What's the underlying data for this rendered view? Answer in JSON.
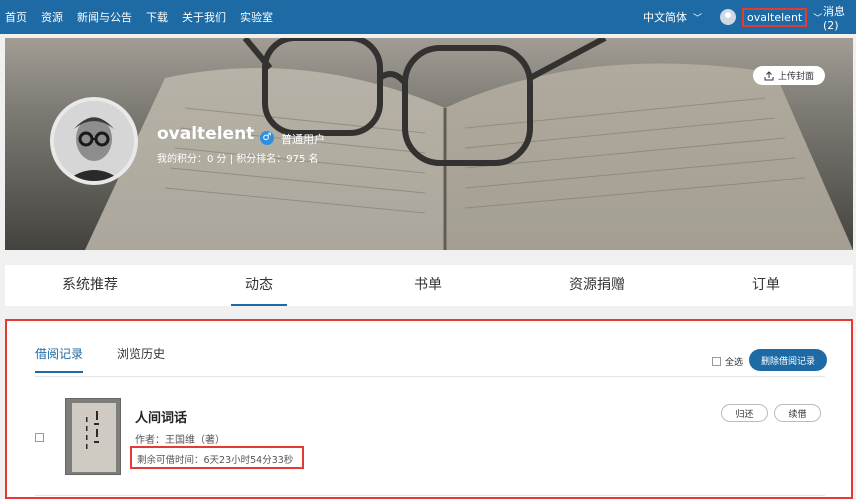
{
  "nav": {
    "links": [
      "首页",
      "资源",
      "新闻与公告",
      "下载",
      "关于我们",
      "实验室"
    ],
    "language": "中文简体",
    "username": "ovaltelent",
    "messages": "消息(2)"
  },
  "profile": {
    "name": "ovaltelent",
    "user_type": "普通用户",
    "stats": "我的积分：0 分 | 积分排名：975 名",
    "upload_cover": "上传封面"
  },
  "tabs": [
    "系统推荐",
    "动态",
    "书单",
    "资源捐赠",
    "订单"
  ],
  "records": {
    "subtabs": [
      "借阅记录",
      "浏览历史"
    ],
    "select_all": "全选",
    "delete_button": "删除借阅记录",
    "items": [
      {
        "title": "人间词话",
        "author": "作者：王国维（著）",
        "remaining": "剩余可借时间：6天23小时54分33秒",
        "return_label": "归还",
        "renew_label": "续借"
      }
    ]
  },
  "colors": {
    "nav_bg": "#1d6aa5",
    "accent": "#1d6aa5",
    "highlight": "#e53935"
  }
}
